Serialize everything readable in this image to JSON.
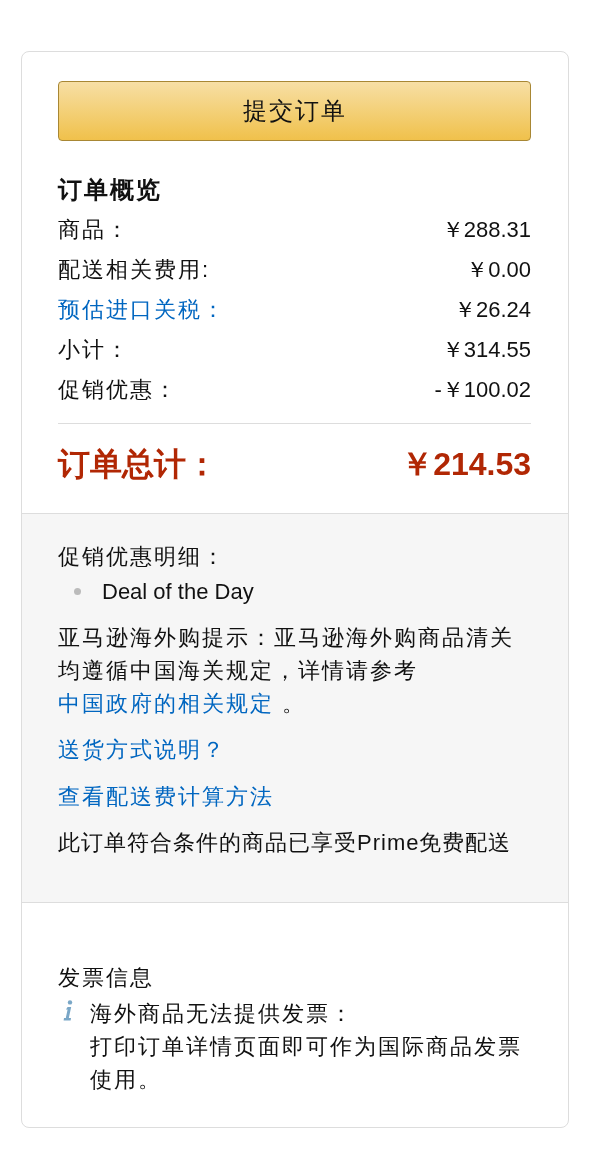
{
  "submit_button": {
    "label": "提交订单"
  },
  "summary": {
    "title": "订单概览",
    "rows": [
      {
        "label": "商品：",
        "value": "￥288.31",
        "kind": "plain"
      },
      {
        "label": "配送相关费用:",
        "value": "￥0.00",
        "kind": "plain"
      },
      {
        "label": "预估进口关税：",
        "value": "￥26.24",
        "kind": "link"
      },
      {
        "label": "小计：",
        "value": "￥314.55",
        "kind": "plain"
      },
      {
        "label": "促销优惠：",
        "value": "-￥100.02",
        "kind": "plain"
      }
    ],
    "total": {
      "label": "订单总计：",
      "value": "￥214.53"
    }
  },
  "details": {
    "promotions_title": "促销优惠明细：",
    "promotions": [
      "Deal of the Day"
    ],
    "notice": {
      "text": "亚马逊海外购提示：亚马逊海外购商品清关均遵循中国海关规定，详情请参考 ",
      "link": "中国政府的相关规定",
      "after": " 。"
    },
    "links": [
      "送货方式说明？",
      "查看配送费计算方法"
    ],
    "prime_note": "此订单符合条件的商品已享受Prime免费配送"
  },
  "invoice": {
    "title": "发票信息",
    "notice_title": "海外商品无法提供发票：",
    "notice_text": "打印订单详情页面即可作为国际商品发票使用。"
  }
}
